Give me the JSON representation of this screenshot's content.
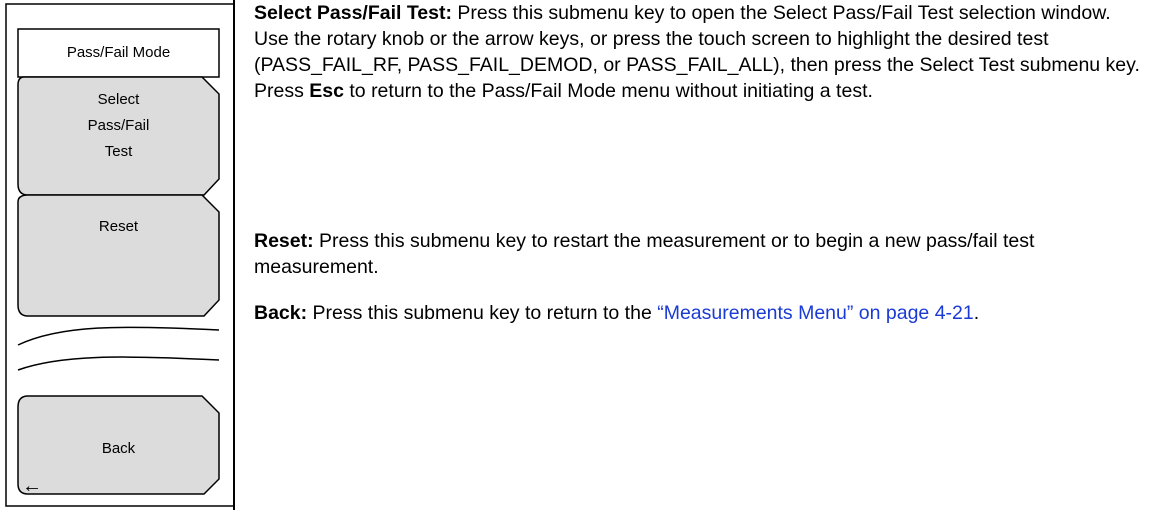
{
  "menu": {
    "title": "Pass/Fail Mode",
    "keys": [
      {
        "label_lines": [
          "Select",
          "Pass/Fail",
          "Test"
        ]
      },
      {
        "label": "Reset"
      },
      {
        "label": "Back",
        "icon": "left-arrow-icon"
      }
    ],
    "back_arrow_glyph": "←"
  },
  "descriptions": {
    "select": {
      "term": "Select Pass/Fail Test:",
      "text_1": " Press this submenu key to open the Select Pass/Fail Test selection window. Use the rotary knob or the arrow keys, or press the touch screen to highlight the desired test (PASS_FAIL_RF, PASS_FAIL_DEMOD, or PASS_FAIL_ALL), then press the Select Test submenu key. Press ",
      "key": "Esc",
      "text_2": " to return to the Pass/Fail Mode menu without initiating a test."
    },
    "reset": {
      "term": "Reset:",
      "text": " Press this submenu key to restart the measurement or to begin a new pass/fail test measurement."
    },
    "back": {
      "term": "Back:",
      "text_1": " Press this submenu key to return to the ",
      "link": "“Measurements Menu” on page 4-21",
      "text_2": "."
    }
  },
  "colors": {
    "key_fill": "#dcdcdc",
    "link": "#1a3ad6"
  }
}
